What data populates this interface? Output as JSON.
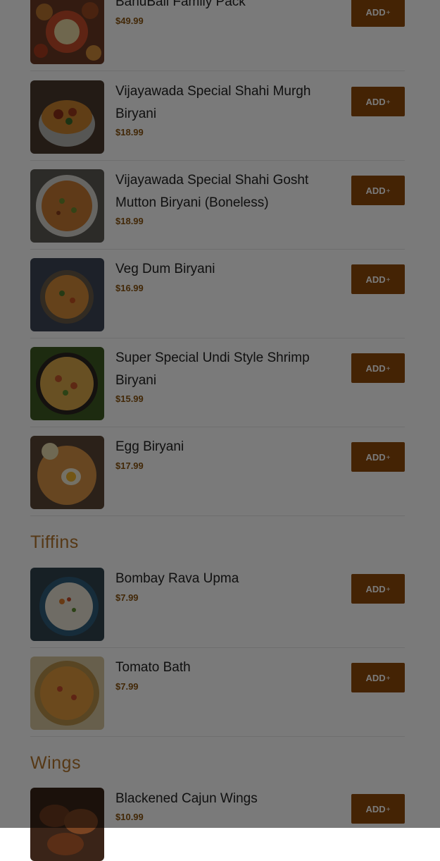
{
  "colors": {
    "add_button": "#8f4a0a",
    "price": "#8a5410",
    "section_title": "#b3752c",
    "overlay": "rgba(0,0,0,0.52)"
  },
  "add_label": "ADD",
  "add_plus": "+",
  "items": [
    {
      "name": "BahuBali Family Pack",
      "price": "$49.99"
    },
    {
      "name": "Vijayawada Special Shahi Murgh Biryani",
      "price": "$18.99"
    },
    {
      "name": "Vijayawada Special Shahi Gosht Mutton Biryani (Boneless)",
      "price": "$18.99"
    },
    {
      "name": "Veg Dum Biryani",
      "price": "$16.99"
    },
    {
      "name": "Super Special Undi Style Shrimp Biryani",
      "price": "$15.99"
    },
    {
      "name": "Egg Biryani",
      "price": "$17.99"
    }
  ],
  "sections": [
    {
      "title": "Tiffins",
      "items": [
        {
          "name": "Bombay Rava Upma",
          "price": "$7.99"
        },
        {
          "name": "Tomato Bath",
          "price": "$7.99"
        }
      ]
    },
    {
      "title": "Wings",
      "items": [
        {
          "name": "Blackened Cajun Wings",
          "price": "$10.99"
        }
      ]
    }
  ]
}
